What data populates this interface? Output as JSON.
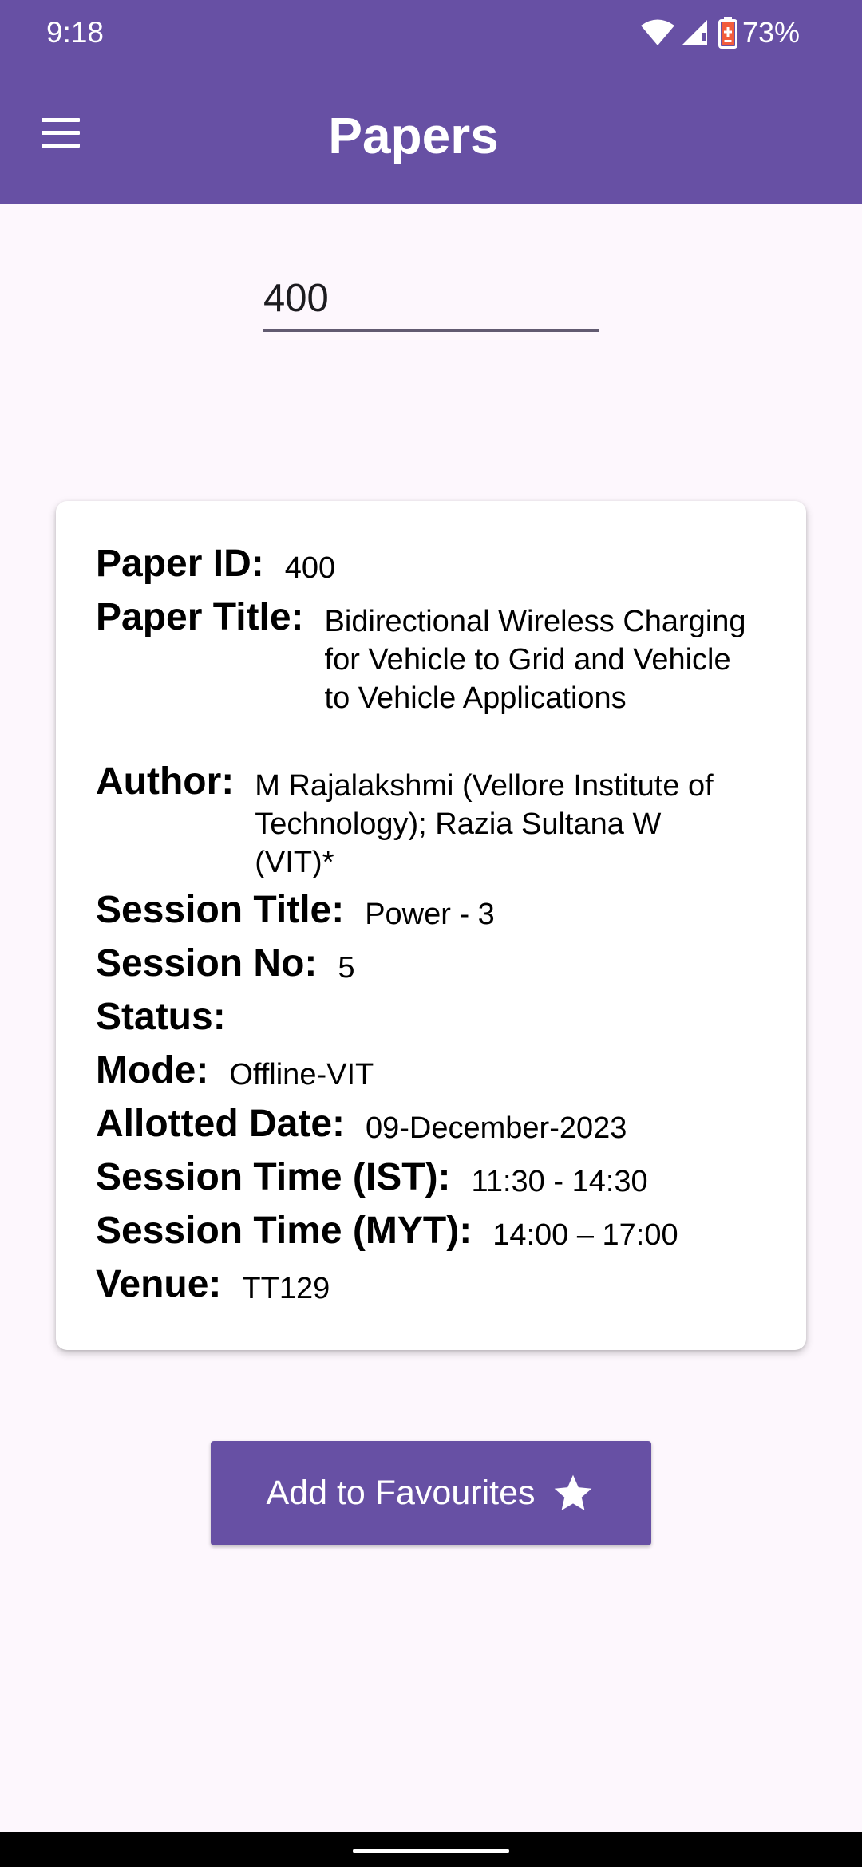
{
  "status_bar": {
    "time": "9:18",
    "battery": "73%",
    "icons": [
      "wifi-icon",
      "signal-icon",
      "battery-icon"
    ]
  },
  "app_bar": {
    "title": "Papers",
    "menu_icon": "menu-icon"
  },
  "search": {
    "value": "400"
  },
  "paper": {
    "id_label": "Paper ID:",
    "id": "400",
    "title_label": "Paper Title:",
    "title": "Bidirectional Wireless Charging for Vehicle to Grid and Vehicle to Vehicle Applications",
    "author_label": "Author:",
    "author": "M Rajalakshmi (Vellore Institute of Technology); Razia Sultana W (VIT)*",
    "session_title_label": "Session Title:",
    "session_title": "Power - 3",
    "session_no_label": "Session No:",
    "session_no": "5",
    "status_label": "Status:",
    "status": "",
    "mode_label": "Mode:",
    "mode": "Offline-VIT",
    "date_label": "Allotted Date:",
    "date": "09-December-2023",
    "time_ist_label": "Session Time (IST):",
    "time_ist": "11:30 - 14:30",
    "time_myt_label": "Session Time (MYT):",
    "time_myt": "14:00 – 17:00",
    "venue_label": "Venue:",
    "venue": "TT129"
  },
  "actions": {
    "add_favourite_label": "Add to Favourites",
    "add_favourite_icon": "star-icon"
  },
  "colors": {
    "primary": "#6750a4",
    "background": "#fdf7fd",
    "card": "#ffffff",
    "underline": "#625b71",
    "battery_alert": "#f25c3c"
  }
}
